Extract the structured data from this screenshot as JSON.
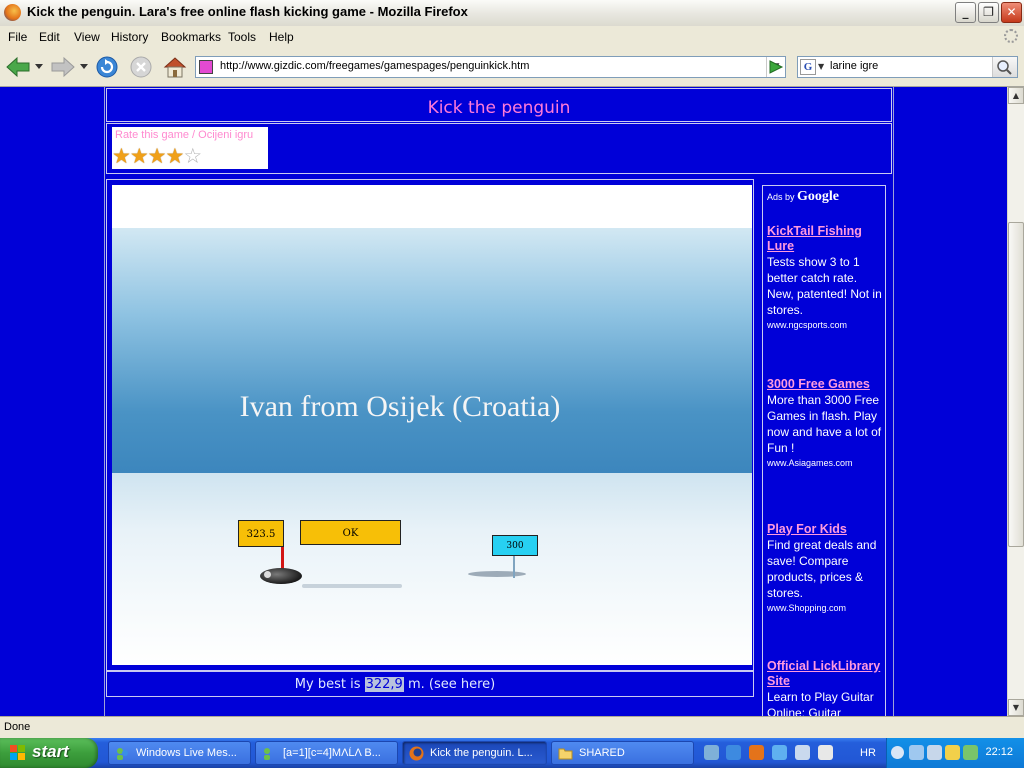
{
  "window": {
    "title": "Kick the penguin. Lara's free online flash kicking game - Mozilla Firefox",
    "controls": [
      "_",
      "❐",
      "✕"
    ]
  },
  "menu": [
    "File",
    "Edit",
    "View",
    "History",
    "Bookmarks",
    "Tools",
    "Help"
  ],
  "toolbar": {
    "url": "http://www.gizdic.com/freegames/gamespages/penguinkick.htm",
    "search_engine": "G",
    "search_query": "larine igre"
  },
  "page": {
    "game_title": "Kick the penguin",
    "rate_label": "Rate this game / Ocijeni igru",
    "rating": {
      "stars": 4,
      "max": 5
    },
    "game": {
      "player_name": "Ivan from Osijek (Croatia)",
      "score_sign": "323.5",
      "ok_button": "OK",
      "marker_sign": "300"
    },
    "best": {
      "prefix": "My best is ",
      "value": "322,9",
      "suffix": " m. (see here)"
    },
    "ads": {
      "ads_by": "Ads by",
      "brand": "Google",
      "items": [
        {
          "title": "KickTail Fishing Lure",
          "desc": "Tests show 3 to 1 better catch rate. New, patented! Not in stores.",
          "url": "www.ngcsports.com"
        },
        {
          "title": "3000 Free Games",
          "desc": "More than 3000 Free Games in flash. Play now and have a lot of Fun !",
          "url": "www.Asiagames.com"
        },
        {
          "title": "Play For Kids",
          "desc": "Find great deals and save! Compare products, prices & stores.",
          "url": "www.Shopping.com"
        },
        {
          "title": "Official LickLibrary Site",
          "desc": "Learn to Play Guitar Online: Guitar",
          "url": ""
        }
      ]
    }
  },
  "status": "Done",
  "taskbar": {
    "start": "start",
    "tasks": [
      {
        "label": "Windows Live Mes...",
        "active": false
      },
      {
        "label": "[a=1][c=4]MΛĹΛ B...",
        "active": false
      },
      {
        "label": "Kick the penguin. L...",
        "active": true
      },
      {
        "label": "SHARED",
        "active": false
      }
    ],
    "language": "HR",
    "clock": "22:12"
  }
}
